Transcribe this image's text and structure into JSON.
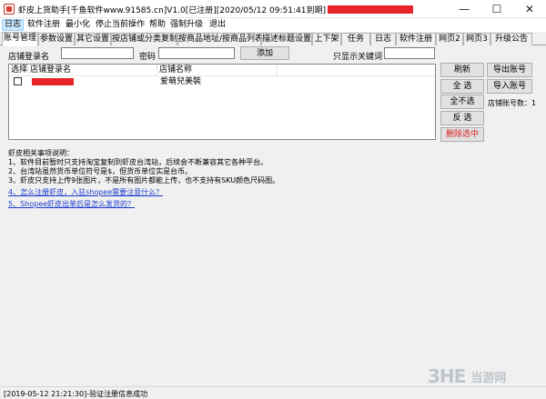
{
  "window": {
    "title": "虾皮上货助手[千鱼软件www.91585.cn]V1.0[已注册][2020/05/12 09:51:41到期]",
    "controls": {
      "minimize": "—",
      "maximize": "☐",
      "close": "✕"
    }
  },
  "menu": [
    "日志",
    "软件注册",
    "最小化",
    "停止当前操作",
    "帮助",
    "强制升级",
    "退出"
  ],
  "tabs": [
    "账号管理",
    "参数设置",
    "其它设置",
    "按店铺或分类复制",
    "按商品地址/按商品列表",
    "描述标题设置",
    "上下架",
    "任务",
    "日志",
    "软件注册",
    "网页2",
    "网页3",
    "升级公告"
  ],
  "filters": {
    "shop_label": "店铺登录名",
    "password_label": "密码",
    "add_button": "添加",
    "keyword_label": "只显示关键词"
  },
  "grid": {
    "columns": [
      "选择",
      "店铺登录名",
      "店铺名称"
    ],
    "rows": [
      {
        "shop_name": "爱萌兒美裝"
      }
    ]
  },
  "actions": {
    "refresh": "刷新",
    "export": "导出账号",
    "select_all": "全 选",
    "import": "导入账号",
    "deselect_all": "全不选",
    "shop_count": "店铺账号数：1",
    "invert": "反 选",
    "delete_selected": "删除选中"
  },
  "notes": {
    "title": "虾皮相关事项说明：",
    "lines": [
      "1、软件目前暂时只支持淘宝复制到虾皮台湾站，后续会不断兼容其它各种平台。",
      "2、台湾站虽然货币单位符号是$，但货币单位实是台币。",
      "3、虾皮只支持上传9张图片，不是所有图片都能上传，也不支持有SKU颜色尺码图。"
    ],
    "links": [
      "4、怎么注册虾皮，入驻shopee需要注意什么？",
      "5、Shopee虾皮出单后是怎么发货的？"
    ]
  },
  "status": {
    "log": "[2019-05-12 21:21:30]-验证注册信息成功"
  },
  "watermark": {
    "logo": "3HE",
    "text": "当游网"
  }
}
